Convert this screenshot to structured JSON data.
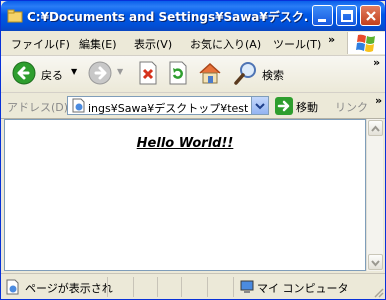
{
  "window": {
    "title": "C:¥Documents and Settings¥Sawa¥デスク..."
  },
  "menu": [
    "ファイル(F)",
    "編集(E)",
    "表示(V)",
    "お気に入り(A)",
    "ツール(T)"
  ],
  "toolbar": {
    "back_label": "戻る",
    "search_label": "検索",
    "more": "»"
  },
  "address": {
    "label": "アドレス(D)",
    "value": "ings¥Sawa¥デスクトップ¥test.html",
    "go_label": "移動",
    "links_label": "リンク"
  },
  "page": {
    "heading": "Hello World!!"
  },
  "status": {
    "text": "ページが表示され",
    "zone": "マイ コンピュータ"
  },
  "colors": {
    "titlebar": "#0058E6",
    "chrome": "#ECE9D8",
    "go_green": "#2E9E2E",
    "close_red": "#C2401C"
  }
}
